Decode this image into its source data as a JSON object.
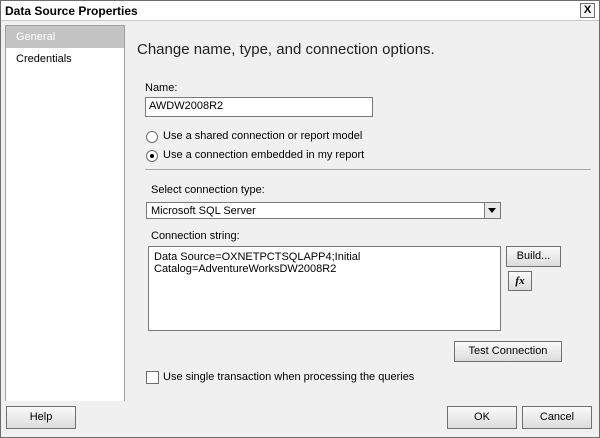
{
  "window": {
    "title": "Data Source Properties",
    "close_label": "X"
  },
  "sidebar": {
    "items": [
      {
        "label": "General"
      },
      {
        "label": "Credentials"
      }
    ]
  },
  "main": {
    "heading": "Change name, type, and connection options.",
    "name_label": "Name:",
    "name_value": "AWDW2008R2",
    "radio_shared": "Use a shared connection or report model",
    "radio_embedded": "Use a connection embedded in my report",
    "conn_type_label": "Select connection type:",
    "conn_type_value": "Microsoft SQL Server",
    "conn_string_label": "Connection string:",
    "conn_string_lines": [
      "Data Source=OXNETPCTSQLAPP4;Initial",
      "Catalog=AdventureWorksDW2008R2"
    ],
    "build_button": "Build...",
    "fx_button": "fx",
    "test_connection_button": "Test Connection",
    "single_transaction_label": "Use single transaction when processing the queries"
  },
  "footer": {
    "help": "Help",
    "ok": "OK",
    "cancel": "Cancel"
  }
}
